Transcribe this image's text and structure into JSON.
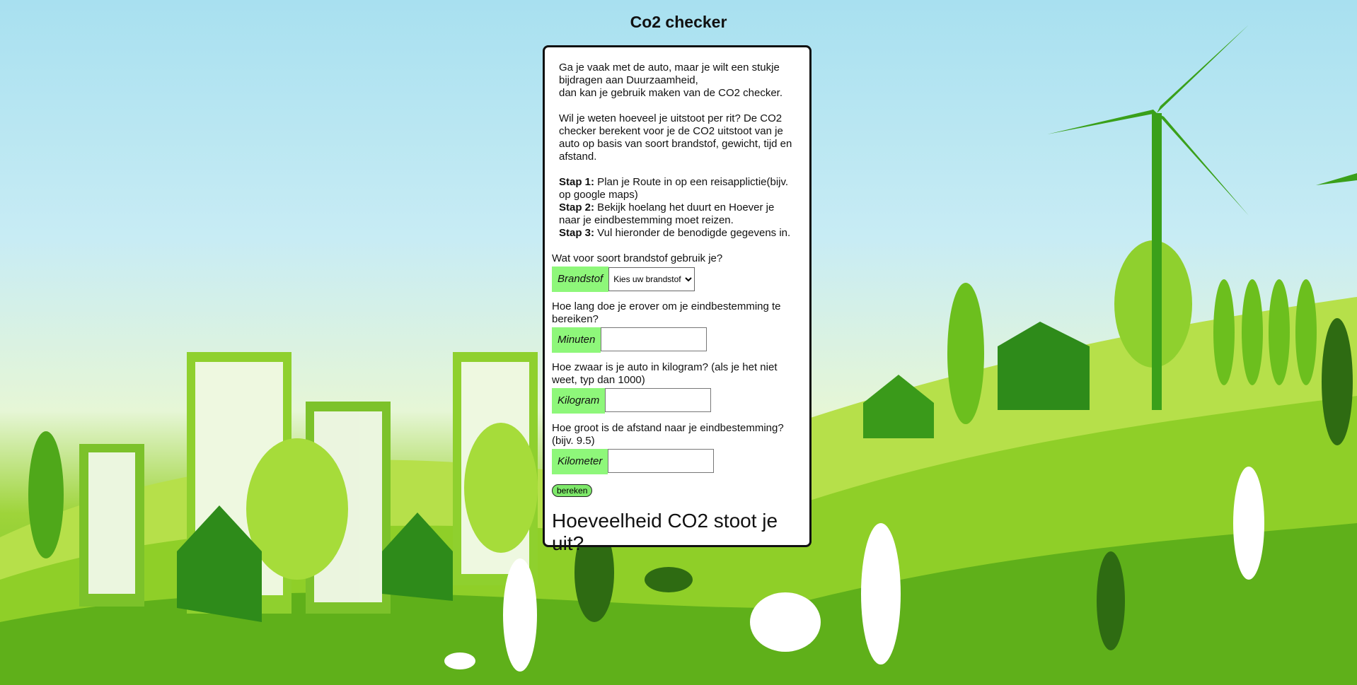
{
  "page": {
    "title": "Co2 checker"
  },
  "intro": {
    "p1_line1": "Ga je vaak met de auto, maar je wilt een stukje bijdragen aan Duurzaamheid,",
    "p1_line2": "dan kan je gebruik maken van de CO2 checker.",
    "p2": "Wil je weten hoeveel je uitstoot per rit? De CO2 checker berekent voor je de CO2 uitstoot van je auto op basis van soort brandstof, gewicht, tijd en afstand.",
    "steps": [
      {
        "label": "Stap 1:",
        "text": " Plan je Route in op een reisapplictie(bijv. op google maps)"
      },
      {
        "label": "Stap 2:",
        "text": " Bekijk hoelang het duurt en Hoever je naar je eindbestemming moet reizen."
      },
      {
        "label": "Stap 3:",
        "text": " Vul hieronder de benodigde gegevens in."
      }
    ]
  },
  "form": {
    "fuel": {
      "question": "Wat voor soort brandstof gebruik je?",
      "label": "Brandstof",
      "selected": "Kies uw brandstof"
    },
    "minutes": {
      "question": "Hoe lang doe je erover om je eindbestemming te bereiken?",
      "label": "Minuten",
      "value": ""
    },
    "weight": {
      "question": "Hoe zwaar is je auto in kilogram? (als je het niet weet, typ dan 1000)",
      "label": "Kilogram",
      "value": ""
    },
    "distance": {
      "question": "Hoe groot is de afstand naar je eindbestemming? (bijv. 9.5)",
      "label": "Kilometer",
      "value": ""
    },
    "submit_label": "bereken"
  },
  "result": {
    "heading": "Hoeveelheid CO2 stoot je uit?"
  },
  "colors": {
    "label_bg": "#8ef77a",
    "button_bg": "#7ee86a",
    "grass": "#6cbf1e",
    "sky": "#a8e0f0"
  }
}
